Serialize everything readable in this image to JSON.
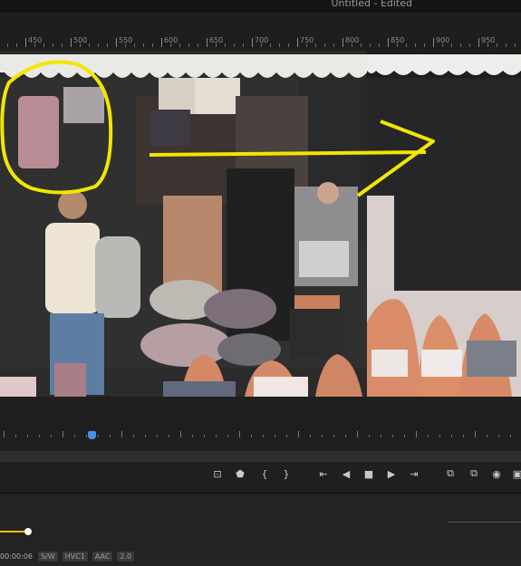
{
  "window": {
    "title": "Untitled - Edited"
  },
  "ruler": {
    "labels": [
      "450",
      "500",
      "550",
      "600",
      "650",
      "700",
      "750",
      "800",
      "850",
      "900",
      "950"
    ]
  },
  "status": {
    "timecode": "00:00:06",
    "badges": [
      "S/W",
      "HVC1",
      "AAC",
      "2.0"
    ]
  },
  "controls": [
    {
      "name": "zoom-to-fit-icon",
      "glyph": "⊡"
    },
    {
      "name": "marker-icon",
      "glyph": "⬟"
    },
    {
      "name": "in-point-icon",
      "glyph": "{"
    },
    {
      "name": "out-point-icon",
      "glyph": "}"
    },
    {
      "name": "go-to-in-icon",
      "glyph": "⇤"
    },
    {
      "name": "step-back-icon",
      "glyph": "◀"
    },
    {
      "name": "stop-icon",
      "glyph": "■"
    },
    {
      "name": "play-icon",
      "glyph": "▶"
    },
    {
      "name": "go-to-out-icon",
      "glyph": "⇥"
    },
    {
      "name": "insert-icon",
      "glyph": "⧉"
    },
    {
      "name": "overwrite-icon",
      "glyph": "⧉"
    },
    {
      "name": "camera-icon",
      "glyph": "◉"
    },
    {
      "name": "export-frame-icon",
      "glyph": "▣"
    }
  ],
  "colors": {
    "annotation": "#f2e600",
    "playhead": "#4a90e2",
    "progress": "#e6c300"
  },
  "playback": {
    "playhead_fraction": 0.17,
    "progress_fraction": 0.05
  }
}
